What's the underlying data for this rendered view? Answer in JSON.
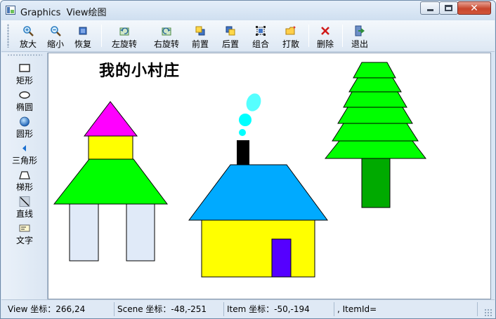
{
  "window": {
    "title": "Graphics  View绘图",
    "minimize_label": "",
    "maximize_label": "",
    "close_label": "✕"
  },
  "toolbar": {
    "items": [
      {
        "label": "放大",
        "icon": "zoom-in-icon"
      },
      {
        "label": "缩小",
        "icon": "zoom-out-icon"
      },
      {
        "label": "恢复",
        "icon": "restore-icon"
      },
      {
        "label": "左旋转",
        "icon": "rotate-left-icon"
      },
      {
        "label": "右旋转",
        "icon": "rotate-right-icon"
      },
      {
        "label": "前置",
        "icon": "bring-front-icon"
      },
      {
        "label": "后置",
        "icon": "send-back-icon"
      },
      {
        "label": "组合",
        "icon": "group-icon"
      },
      {
        "label": "打散",
        "icon": "ungroup-icon"
      },
      {
        "label": "删除",
        "icon": "delete-icon"
      },
      {
        "label": "退出",
        "icon": "exit-icon"
      }
    ]
  },
  "tools": {
    "items": [
      {
        "label": "矩形",
        "icon": "rectangle-icon"
      },
      {
        "label": "椭圆",
        "icon": "ellipse-icon"
      },
      {
        "label": "圆形",
        "icon": "circle-icon"
      },
      {
        "label": "三角形",
        "icon": "triangle-icon"
      },
      {
        "label": "梯形",
        "icon": "trapezoid-icon"
      },
      {
        "label": "直线",
        "icon": "line-icon"
      },
      {
        "label": "文字",
        "icon": "text-icon"
      }
    ]
  },
  "canvas": {
    "title": "我的小村庄",
    "colors": {
      "magenta": "#ff00ff",
      "yellow": "#ffff00",
      "green": "#00ff00",
      "dark_green": "#00aa00",
      "light_blue": "#e0eaf8",
      "sky_blue": "#00aaff",
      "cyan": "#00ffff",
      "light_cyan": "#55ffff",
      "purple": "#5500ff",
      "black": "#000000"
    }
  },
  "status": {
    "view_coord": "View 坐标：266,24",
    "scene_coord": "Scene 坐标：-48,-251",
    "item_coord": "Item 坐标：-50,-194",
    "item_id": ", ItemId="
  }
}
